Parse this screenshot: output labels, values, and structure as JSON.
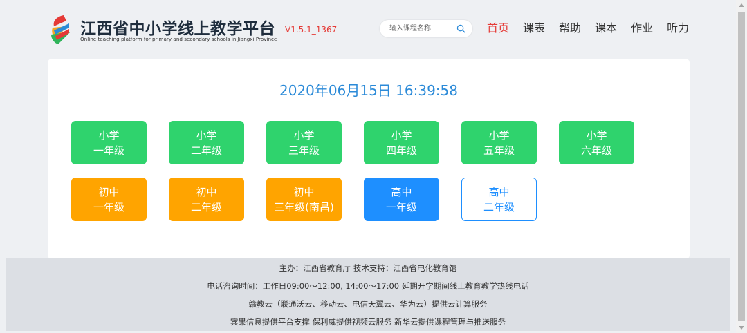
{
  "header": {
    "title": "江西省中小学线上教学平台",
    "subtitle": "Online teaching platform for primary and secondary schools in Jiangxi Province",
    "version": "V1.5.1_1367",
    "search": {
      "placeholder": "输入课程名称",
      "value": ""
    },
    "nav": [
      {
        "label": "首页",
        "active": true
      },
      {
        "label": "课表",
        "active": false
      },
      {
        "label": "帮助",
        "active": false
      },
      {
        "label": "课本",
        "active": false
      },
      {
        "label": "作业",
        "active": false
      },
      {
        "label": "听力",
        "active": false
      }
    ]
  },
  "main": {
    "datetime": "2020年06月15日 16:39:58",
    "grades_row1": [
      {
        "line1": "小学",
        "line2": "一年级",
        "style": "green"
      },
      {
        "line1": "小学",
        "line2": "二年级",
        "style": "green"
      },
      {
        "line1": "小学",
        "line2": "三年级",
        "style": "green"
      },
      {
        "line1": "小学",
        "line2": "四年级",
        "style": "green"
      },
      {
        "line1": "小学",
        "line2": "五年级",
        "style": "green"
      },
      {
        "line1": "小学",
        "line2": "六年级",
        "style": "green"
      }
    ],
    "grades_row2": [
      {
        "line1": "初中",
        "line2": "一年级",
        "style": "orange"
      },
      {
        "line1": "初中",
        "line2": "二年级",
        "style": "orange"
      },
      {
        "line1": "初中",
        "line2": "三年级(南昌)",
        "style": "orange"
      },
      {
        "line1": "高中",
        "line2": "一年级",
        "style": "blue"
      },
      {
        "line1": "高中",
        "line2": "二年级",
        "style": "outline"
      }
    ]
  },
  "footer": {
    "lines": [
      "主办：江西省教育厅 技术支持：江西省电化教育馆",
      "电话咨询时间：工作日09:00～12:00, 14:00～17:00 延期开学期间线上教育教学热线电话",
      "赣教云（联通沃云、移动云、电信天翼云、华为云）提供云计算服务",
      "宾果信息提供平台支撑 保利威提供视频云服务 新华云提供课程管理与推送服务"
    ]
  },
  "colors": {
    "accent_red": "#e53935",
    "datetime_blue": "#2b8ad8",
    "green": "#2fd36d",
    "orange": "#ffa400",
    "blue": "#1e8fff"
  }
}
